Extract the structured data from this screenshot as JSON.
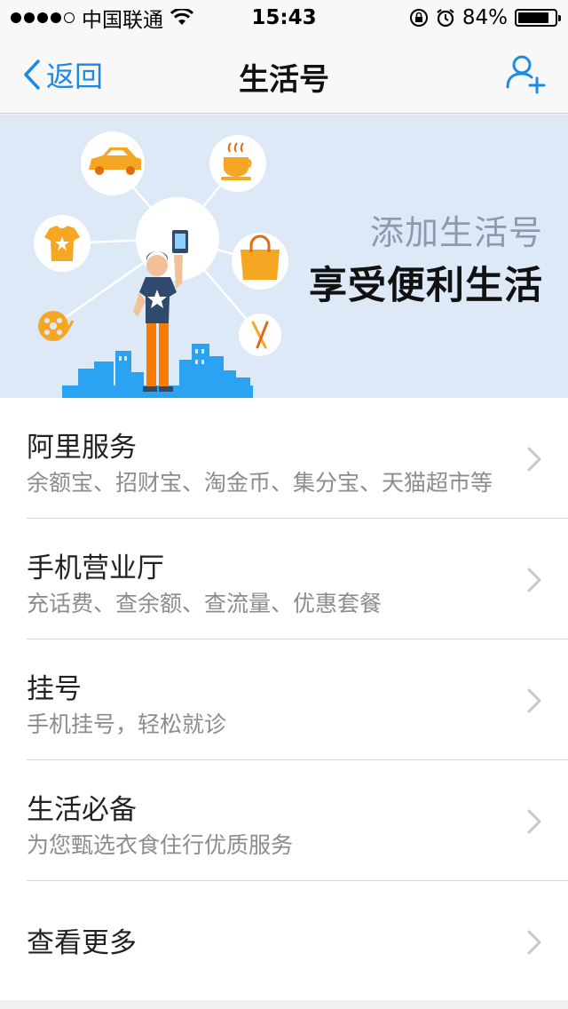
{
  "status_bar": {
    "carrier": "中国联通",
    "time": "15:43",
    "battery": "84%",
    "battery_level": 0.84,
    "signal_bars_filled": 4,
    "signal_bars_total": 5
  },
  "nav": {
    "back_label": "返回",
    "title": "生活号",
    "accent_color": "#1e88e5"
  },
  "banner": {
    "subtitle": "添加生活号",
    "headline": "享受便利生活",
    "background_color": "#dde9f7"
  },
  "list": {
    "items": [
      {
        "title": "阿里服务",
        "desc": "余额宝、招财宝、淘金币、集分宝、天猫超市等"
      },
      {
        "title": "手机营业厅",
        "desc": "充话费、查余额、查流量、优惠套餐"
      },
      {
        "title": "挂号",
        "desc": "手机挂号，轻松就诊"
      },
      {
        "title": "生活必备",
        "desc": "为您甄选衣食住行优质服务"
      },
      {
        "title": "查看更多"
      }
    ]
  },
  "icons": {
    "back": "chevron-left-icon",
    "add_user": "add-user-icon",
    "row_arrow": "chevron-right-icon"
  }
}
